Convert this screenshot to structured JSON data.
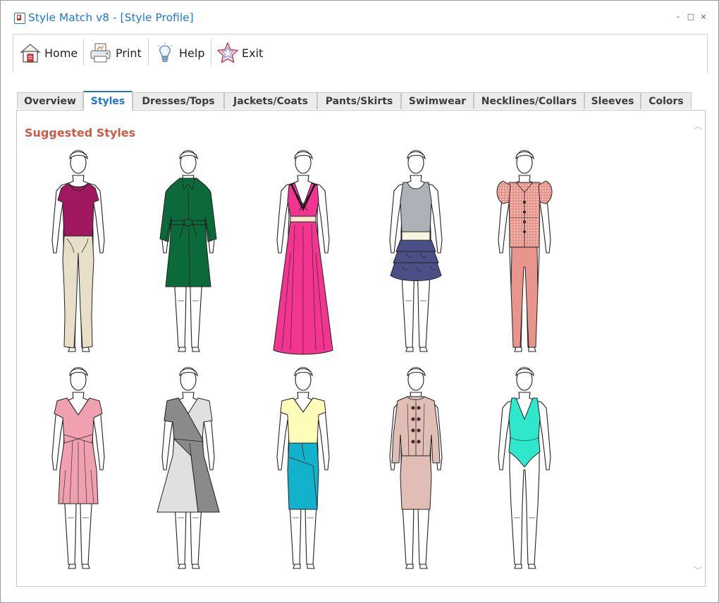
{
  "window": {
    "title": "Style Match v8 - [Style Profile]",
    "controls": {
      "minimize": "–",
      "maximize": "□",
      "close": "×"
    }
  },
  "toolbar": {
    "buttons": [
      {
        "label": "Home",
        "icon": "house-icon"
      },
      {
        "label": "Print",
        "icon": "printer-icon"
      },
      {
        "label": "Help",
        "icon": "lightbulb-icon"
      },
      {
        "label": "Exit",
        "icon": "star-icon"
      }
    ]
  },
  "tabs": [
    {
      "label": "Overview",
      "active": false
    },
    {
      "label": "Styles",
      "active": true
    },
    {
      "label": "Dresses/Tops",
      "active": false
    },
    {
      "label": "Jackets/Coats",
      "active": false
    },
    {
      "label": "Pants/Skirts",
      "active": false
    },
    {
      "label": "Swimwear",
      "active": false
    },
    {
      "label": "Necklines/Collars",
      "active": false
    },
    {
      "label": "Sleeves",
      "active": false
    },
    {
      "label": "Colors",
      "active": false
    }
  ],
  "content": {
    "section_title": "Suggested Styles",
    "styles": [
      {
        "name": "magenta-top-beige-pants",
        "colors": [
          "#a0185f",
          "#e8dfc8"
        ]
      },
      {
        "name": "green-belted-coat",
        "colors": [
          "#0c6a3a"
        ]
      },
      {
        "name": "pink-maxi-dress",
        "colors": [
          "#f23590"
        ]
      },
      {
        "name": "gray-top-ruffled-skirt",
        "colors": [
          "#aeb2b8",
          "#4a4f86"
        ]
      },
      {
        "name": "dotted-blouse-pink-pants",
        "colors": [
          "#e8958c"
        ]
      },
      {
        "name": "pink-fitted-dress",
        "colors": [
          "#f1a0b0"
        ]
      },
      {
        "name": "gray-wrap-dress",
        "colors": [
          "#8a8a8a",
          "#e0e0e0"
        ]
      },
      {
        "name": "yellow-top-teal-skirt",
        "colors": [
          "#fdfcb8",
          "#12b1cc"
        ]
      },
      {
        "name": "rose-button-jacket-skirt",
        "colors": [
          "#e0bdb5"
        ]
      },
      {
        "name": "turquoise-swimsuit",
        "colors": [
          "#2fe8cc"
        ]
      }
    ]
  },
  "colors": {
    "accent": "#1e78d2",
    "section_title": "#cf5a45"
  }
}
